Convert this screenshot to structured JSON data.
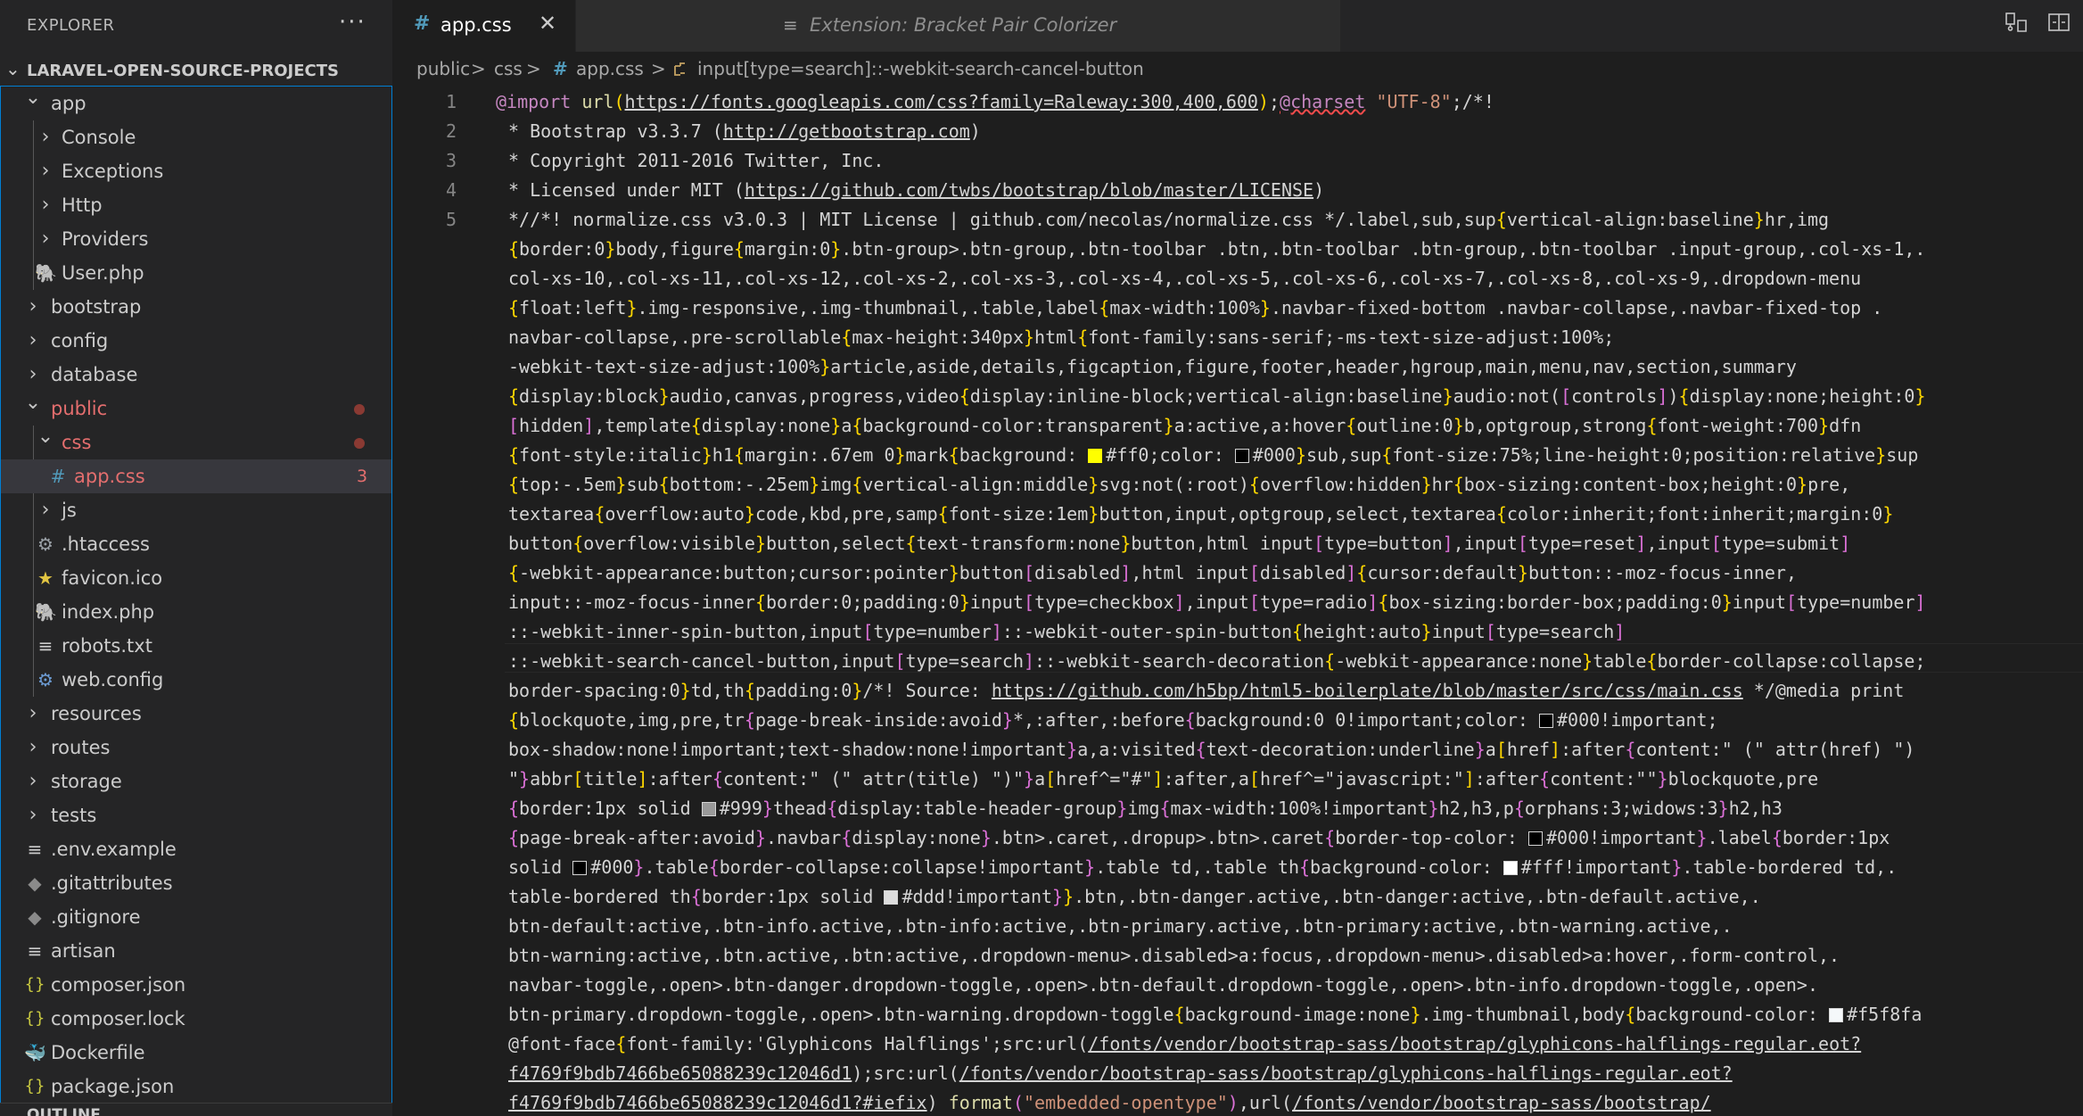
{
  "explorer": {
    "title": "EXPLORER",
    "more": "···",
    "project": "LARAVEL-OPEN-SOURCE-PROJECTS",
    "outline": "OUTLINE"
  },
  "tree": [
    {
      "label": "app",
      "kind": "folder-open",
      "depth": 1
    },
    {
      "label": "Console",
      "kind": "folder",
      "depth": 2
    },
    {
      "label": "Exceptions",
      "kind": "folder",
      "depth": 2
    },
    {
      "label": "Http",
      "kind": "folder",
      "depth": 2
    },
    {
      "label": "Providers",
      "kind": "folder",
      "depth": 2
    },
    {
      "label": "User.php",
      "kind": "php-file",
      "depth": 2
    },
    {
      "label": "bootstrap",
      "kind": "folder",
      "depth": 1
    },
    {
      "label": "config",
      "kind": "folder",
      "depth": 1
    },
    {
      "label": "database",
      "kind": "folder",
      "depth": 1
    },
    {
      "label": "public",
      "kind": "folder-open-modified",
      "depth": 1
    },
    {
      "label": "css",
      "kind": "folder-open-modified",
      "depth": 2
    },
    {
      "label": "app.css",
      "kind": "css-file-selected",
      "depth": 3,
      "badge": "3"
    },
    {
      "label": "js",
      "kind": "folder",
      "depth": 2
    },
    {
      "label": ".htaccess",
      "kind": "gear-file",
      "depth": 2
    },
    {
      "label": "favicon.ico",
      "kind": "star-file",
      "depth": 2
    },
    {
      "label": "index.php",
      "kind": "php-file",
      "depth": 2
    },
    {
      "label": "robots.txt",
      "kind": "text-file",
      "depth": 2
    },
    {
      "label": "web.config",
      "kind": "globe-file",
      "depth": 2
    },
    {
      "label": "resources",
      "kind": "folder",
      "depth": 1
    },
    {
      "label": "routes",
      "kind": "folder",
      "depth": 1
    },
    {
      "label": "storage",
      "kind": "folder",
      "depth": 1
    },
    {
      "label": "tests",
      "kind": "folder",
      "depth": 1
    },
    {
      "label": ".env.example",
      "kind": "text-file",
      "depth": 1
    },
    {
      "label": ".gitattributes",
      "kind": "git-file",
      "depth": 1
    },
    {
      "label": ".gitignore",
      "kind": "git-file",
      "depth": 1
    },
    {
      "label": "artisan",
      "kind": "text-file",
      "depth": 1
    },
    {
      "label": "composer.json",
      "kind": "json-file",
      "depth": 1
    },
    {
      "label": "composer.lock",
      "kind": "json-file",
      "depth": 1
    },
    {
      "label": "Dockerfile",
      "kind": "docker-file",
      "depth": 1
    },
    {
      "label": "package.json",
      "kind": "json-file",
      "depth": 1
    }
  ],
  "tabs": {
    "active": {
      "icon": "#",
      "label": "app.css",
      "close": "✕"
    },
    "inactive": {
      "icon": "≡",
      "label": "Extension: Bracket Pair Colorizer"
    }
  },
  "actions": {
    "compare": "compare-changes-icon",
    "split": "split-editor-icon"
  },
  "breadcrumb": {
    "public": "public",
    "css": "css",
    "file_icon": "#",
    "file": "app.css",
    "symbol": "input[type=search]::-webkit-search-cancel-button",
    "sep": ">"
  },
  "gutter": [
    "1",
    "2",
    "3",
    "4",
    "5"
  ],
  "colors": {
    "accent": "#007fd4",
    "modified": "#e46e6e",
    "bracket1": "#ffd700",
    "bracket2": "#da70d6"
  }
}
